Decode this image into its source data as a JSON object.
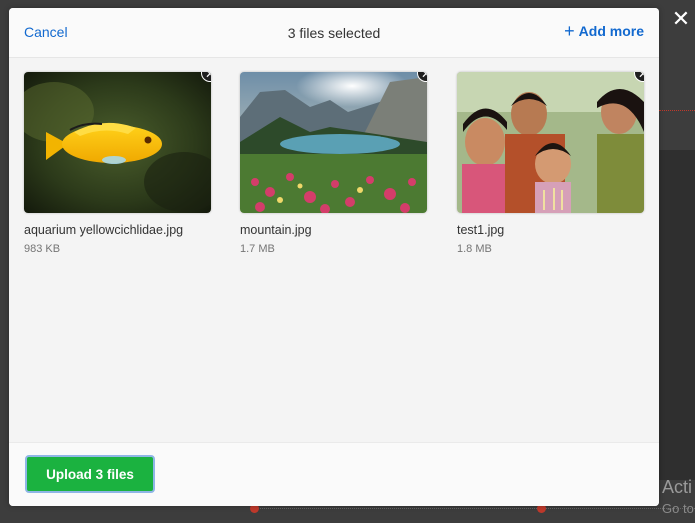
{
  "header": {
    "cancel_label": "Cancel",
    "title": "3 files selected",
    "add_more_label": "Add more"
  },
  "files": [
    {
      "name": "aquarium yellowcichlidae.jpg",
      "size": "983 KB"
    },
    {
      "name": "mountain.jpg",
      "size": "1.7 MB"
    },
    {
      "name": "test1.jpg",
      "size": "1.8 MB"
    }
  ],
  "footer": {
    "upload_label": "Upload 3 files"
  },
  "background": {
    "activate_text": "Acti",
    "activate_sub": "Go to"
  },
  "colors": {
    "accent": "#1269cf",
    "upload": "#1bb240"
  }
}
